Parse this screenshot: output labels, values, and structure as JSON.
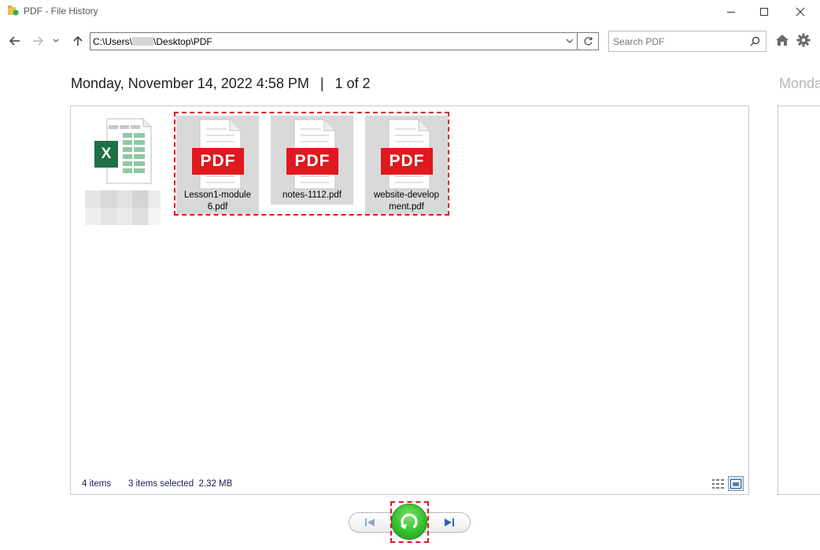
{
  "window": {
    "title": "PDF - File History",
    "icon": "folder-file-history-icon"
  },
  "nav": {
    "address_prefix": "C:\\Users\\",
    "address_suffix": "\\Desktop\\PDF",
    "search_placeholder": "Search PDF"
  },
  "header": {
    "datetime": "Monday, November 14, 2022 4:58 PM",
    "separator": "|",
    "position": "1 of 2",
    "next_preview": "Monday"
  },
  "files": [
    {
      "name_line1": "Lesson1-module",
      "name_line2": "6.pdf",
      "type": "pdf",
      "selected": true
    },
    {
      "name_line1": "notes-1112.pdf",
      "name_line2": "",
      "type": "pdf",
      "selected": true
    },
    {
      "name_line1": "website-develop",
      "name_line2": "ment.pdf",
      "type": "pdf",
      "selected": true
    }
  ],
  "pdf_badge": "PDF",
  "xls_badge": "X",
  "status": {
    "item_count": "4 items",
    "selection": "3 items selected  2.32 MB"
  },
  "colors": {
    "pdf_red": "#e0181f",
    "selection_bg": "#d9d9d9",
    "excel_green": "#1d7044",
    "restore_green": "#35c12e",
    "highlight_outline": "#e0181f"
  }
}
